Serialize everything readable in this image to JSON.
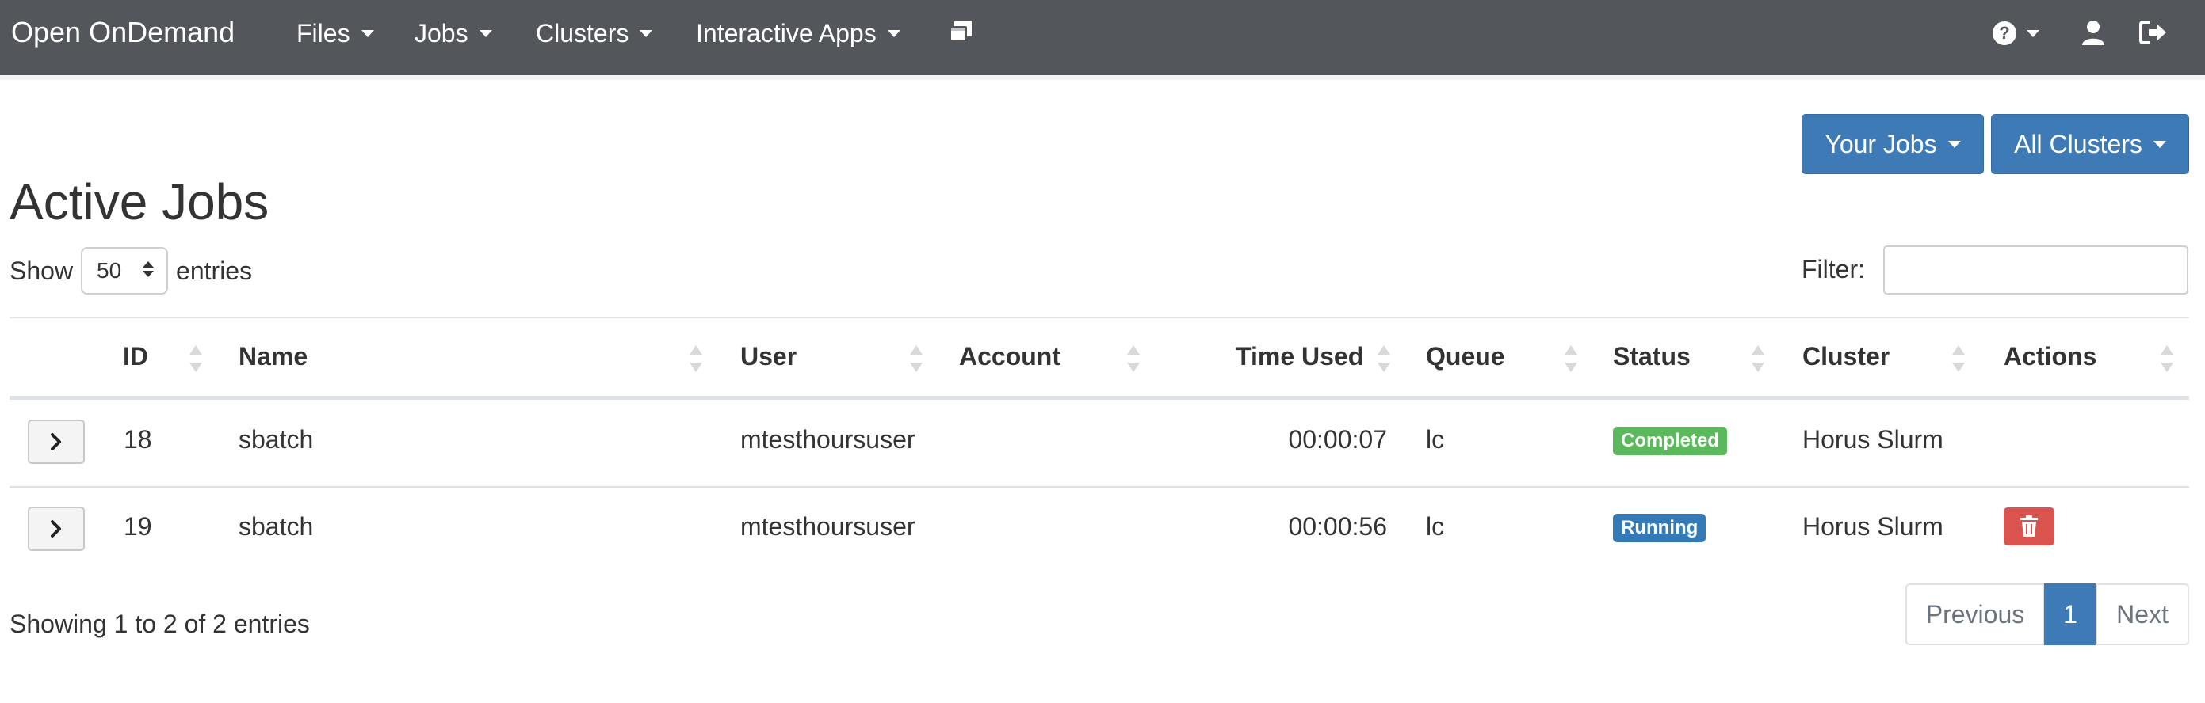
{
  "navbar": {
    "brand": "Open OnDemand",
    "menus": [
      {
        "label": "Files"
      },
      {
        "label": "Jobs"
      },
      {
        "label": "Clusters"
      },
      {
        "label": "Interactive Apps"
      }
    ],
    "icons": [
      "windows-icon",
      "help-icon",
      "user-icon",
      "logout-icon"
    ]
  },
  "filters": {
    "jobs_button": "Your Jobs",
    "clusters_button": "All Clusters"
  },
  "page_title": "Active Jobs",
  "length": {
    "prefix": "Show",
    "value": "50",
    "suffix": "entries"
  },
  "filter": {
    "label": "Filter:",
    "value": ""
  },
  "table": {
    "columns": [
      "ID",
      "Name",
      "User",
      "Account",
      "Time Used",
      "Queue",
      "Status",
      "Cluster",
      "Actions"
    ],
    "rows": [
      {
        "id": "18",
        "name": "sbatch",
        "user": "mtesthoursuser",
        "account": "",
        "time_used": "00:00:07",
        "queue": "lc",
        "status": "Completed",
        "cluster": "Horus Slurm",
        "can_delete": false
      },
      {
        "id": "19",
        "name": "sbatch",
        "user": "mtesthoursuser",
        "account": "",
        "time_used": "00:00:56",
        "queue": "lc",
        "status": "Running",
        "cluster": "Horus Slurm",
        "can_delete": true
      }
    ]
  },
  "footer": {
    "info": "Showing 1 to 2 of 2 entries",
    "previous": "Previous",
    "page": "1",
    "next": "Next"
  },
  "colors": {
    "navbar": "#53565a",
    "primary": "#3e7bb6",
    "completed": "#5cb85c",
    "running": "#337ab7",
    "danger": "#d9534f"
  }
}
